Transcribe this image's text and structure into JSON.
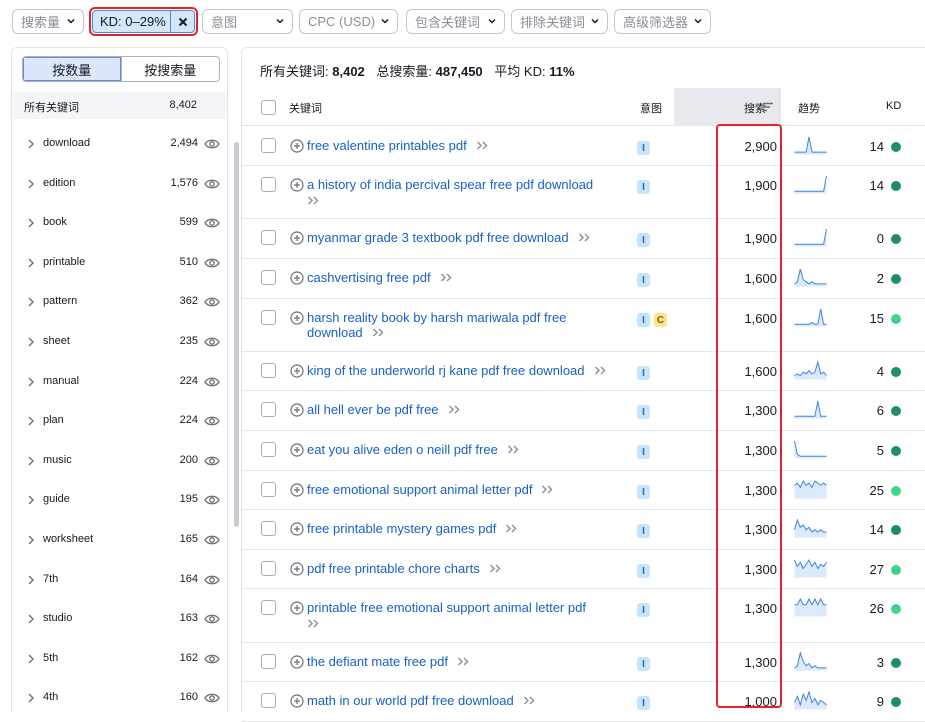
{
  "filters": {
    "volume": "搜索量",
    "kd": "KD: 0–29%",
    "intent": "意图",
    "cpc": "CPC (USD)",
    "include": "包含关键词",
    "exclude": "排除关键词",
    "advanced": "高级筛选器"
  },
  "sidebar": {
    "tab_by_count": "按数量",
    "tab_by_volume": "按搜索量",
    "header_label": "所有关键词",
    "header_count": "8,402",
    "groups": [
      {
        "word": "download",
        "count": "2,494"
      },
      {
        "word": "edition",
        "count": "1,576"
      },
      {
        "word": "book",
        "count": "599"
      },
      {
        "word": "printable",
        "count": "510"
      },
      {
        "word": "pattern",
        "count": "362"
      },
      {
        "word": "sheet",
        "count": "235"
      },
      {
        "word": "manual",
        "count": "224"
      },
      {
        "word": "plan",
        "count": "224"
      },
      {
        "word": "music",
        "count": "200"
      },
      {
        "word": "guide",
        "count": "195"
      },
      {
        "word": "worksheet",
        "count": "165"
      },
      {
        "word": "7th",
        "count": "164"
      },
      {
        "word": "studio",
        "count": "163"
      },
      {
        "word": "5th",
        "count": "162"
      },
      {
        "word": "4th",
        "count": "160"
      }
    ]
  },
  "summary": {
    "all_label": "所有关键词:",
    "all_value": "8,402",
    "total_label": "总搜索量:",
    "total_value": "487,450",
    "avg_label": "平均 KD:",
    "avg_value": "11%"
  },
  "table": {
    "col_keyword": "关键词",
    "col_intent": "意图",
    "col_volume": "搜索",
    "col_trend": "趋势",
    "col_kd": "KD",
    "rows": [
      {
        "keyword": "free valentine printables pdf",
        "intents": [
          "I"
        ],
        "volume": "2,900",
        "trend": [
          1,
          1,
          1,
          1,
          1,
          9,
          1,
          1,
          1,
          1,
          1,
          1
        ],
        "kd": "14",
        "kd_color": "#1e8f5e"
      },
      {
        "keyword": "a history of india percival spear free pdf download",
        "intents": [
          "I"
        ],
        "volume": "1,900",
        "trend": [
          1,
          1,
          1,
          1,
          1,
          1,
          1,
          1,
          1,
          1,
          1,
          10
        ],
        "kd": "14",
        "kd_color": "#1e8f5e"
      },
      {
        "keyword": "myanmar grade 3 textbook pdf free download",
        "intents": [
          "I"
        ],
        "volume": "1,900",
        "trend": [
          1,
          1,
          1,
          1,
          1,
          1,
          1,
          1,
          1,
          1,
          1,
          10
        ],
        "kd": "0",
        "kd_color": "#1e8f5e"
      },
      {
        "keyword": "cashvertising free pdf",
        "intents": [
          "I"
        ],
        "volume": "1,600",
        "trend": [
          1,
          2,
          8,
          3,
          2,
          1,
          2,
          1,
          1,
          1,
          1,
          1
        ],
        "kd": "2",
        "kd_color": "#1e8f5e"
      },
      {
        "keyword": "harsh reality book by harsh mariwala pdf free download",
        "intents": [
          "I",
          "C"
        ],
        "volume": "1,600",
        "trend": [
          1,
          1,
          1,
          1,
          1,
          1,
          2,
          1,
          1,
          10,
          1,
          1
        ],
        "kd": "15",
        "kd_color": "#3ed58a"
      },
      {
        "keyword": "king of the underworld rj kane pdf free download",
        "intents": [
          "I"
        ],
        "volume": "1,600",
        "trend": [
          2,
          3,
          2,
          4,
          3,
          5,
          3,
          4,
          10,
          3,
          4,
          2
        ],
        "kd": "4",
        "kd_color": "#1e8f5e"
      },
      {
        "keyword": "all hell ever be pdf free",
        "intents": [
          "I"
        ],
        "volume": "1,300",
        "trend": [
          1,
          1,
          1,
          1,
          1,
          1,
          1,
          1,
          10,
          1,
          1,
          1
        ],
        "kd": "6",
        "kd_color": "#1e8f5e"
      },
      {
        "keyword": "eat you alive eden o neill pdf free",
        "intents": [
          "I"
        ],
        "volume": "1,300",
        "trend": [
          10,
          2,
          1,
          1,
          1,
          1,
          1,
          1,
          1,
          1,
          1,
          1
        ],
        "kd": "5",
        "kd_color": "#1e8f5e"
      },
      {
        "keyword": "free emotional support animal letter pdf",
        "intents": [
          "I"
        ],
        "volume": "1,300",
        "trend": [
          6,
          7,
          5,
          8,
          6,
          7,
          5,
          8,
          7,
          6,
          7,
          6
        ],
        "kd": "25",
        "kd_color": "#3ed58a"
      },
      {
        "keyword": "free printable mystery games pdf",
        "intents": [
          "I"
        ],
        "volume": "1,300",
        "trend": [
          3,
          7,
          4,
          5,
          3,
          4,
          2,
          3,
          2,
          3,
          2,
          2
        ],
        "kd": "14",
        "kd_color": "#1e8f5e"
      },
      {
        "keyword": "pdf free printable chore charts",
        "intents": [
          "I"
        ],
        "volume": "1,300",
        "trend": [
          8,
          5,
          7,
          4,
          6,
          8,
          5,
          7,
          4,
          6,
          5,
          7
        ],
        "kd": "27",
        "kd_color": "#3ed58a"
      },
      {
        "keyword": "printable free emotional support animal letter pdf",
        "intents": [
          "I"
        ],
        "volume": "1,300",
        "trend": [
          2,
          2,
          3,
          2,
          2,
          3,
          2,
          3,
          2,
          3,
          2,
          2
        ],
        "kd": "26",
        "kd_color": "#3ed58a"
      },
      {
        "keyword": "the defiant mate free pdf",
        "intents": [
          "I"
        ],
        "volume": "1,300",
        "trend": [
          1,
          2,
          8,
          4,
          2,
          3,
          1,
          2,
          1,
          1,
          1,
          1
        ],
        "kd": "3",
        "kd_color": "#1e8f5e"
      },
      {
        "keyword": "math in our world pdf free download",
        "intents": [
          "I"
        ],
        "volume": "1,000",
        "trend": [
          3,
          6,
          2,
          7,
          4,
          8,
          3,
          5,
          2,
          4,
          3,
          2
        ],
        "kd": "9",
        "kd_color": "#1e8f5e"
      }
    ]
  },
  "colors": {
    "accent": "#1860c8",
    "highlight": "#e0242a"
  }
}
